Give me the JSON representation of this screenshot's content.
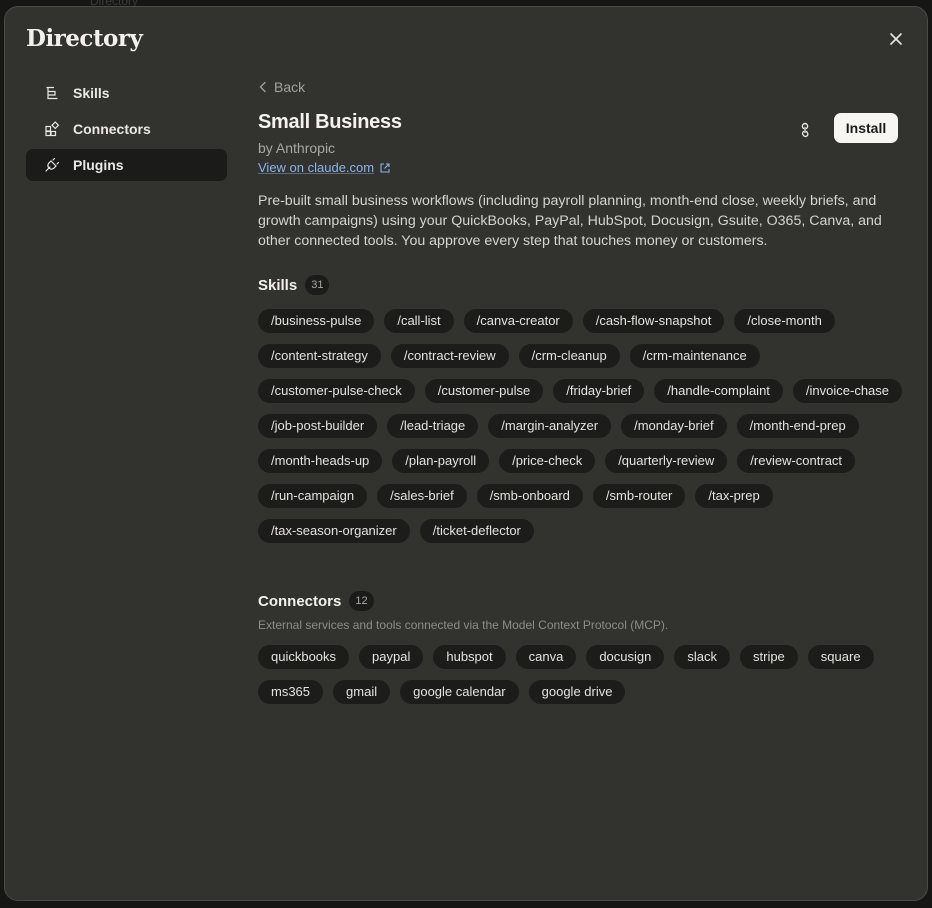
{
  "backdrop": {
    "ghost_text": "Directory"
  },
  "modal": {
    "title": "Directory"
  },
  "sidebar": {
    "items": [
      {
        "label": "Skills",
        "icon": "skills-icon"
      },
      {
        "label": "Connectors",
        "icon": "connectors-icon"
      },
      {
        "label": "Plugins",
        "icon": "plugin-icon",
        "active": true
      }
    ]
  },
  "content": {
    "back_label": "Back",
    "title": "Small Business",
    "author": "by Anthropic",
    "view_link": "View on claude.com",
    "install_label": "Install",
    "description": "Pre-built small business workflows (including payroll planning, month-end close, weekly briefs, and growth campaigns) using your QuickBooks, PayPal, HubSpot, Docusign, Gsuite, O365, Canva, and other connected tools. You approve every step that touches money or customers.",
    "skills": {
      "title": "Skills",
      "count": "31",
      "items": [
        "/business-pulse",
        "/call-list",
        "/canva-creator",
        "/cash-flow-snapshot",
        "/close-month",
        "/content-strategy",
        "/contract-review",
        "/crm-cleanup",
        "/crm-maintenance",
        "/customer-pulse-check",
        "/customer-pulse",
        "/friday-brief",
        "/handle-complaint",
        "/invoice-chase",
        "/job-post-builder",
        "/lead-triage",
        "/margin-analyzer",
        "/monday-brief",
        "/month-end-prep",
        "/month-heads-up",
        "/plan-payroll",
        "/price-check",
        "/quarterly-review",
        "/review-contract",
        "/run-campaign",
        "/sales-brief",
        "/smb-onboard",
        "/smb-router",
        "/tax-prep",
        "/tax-season-organizer",
        "/ticket-deflector"
      ]
    },
    "connectors": {
      "title": "Connectors",
      "count": "12",
      "subtitle": "External services and tools connected via the Model Context Protocol (MCP).",
      "items": [
        "quickbooks",
        "paypal",
        "hubspot",
        "canva",
        "docusign",
        "slack",
        "stripe",
        "square",
        "ms365",
        "gmail",
        "google calendar",
        "google drive"
      ]
    }
  },
  "colors": {
    "accent_link": "#8cb4e8",
    "panel_bg": "#32322f",
    "chip_bg": "#1c1c1a",
    "install_bg": "#f7f6f2"
  }
}
